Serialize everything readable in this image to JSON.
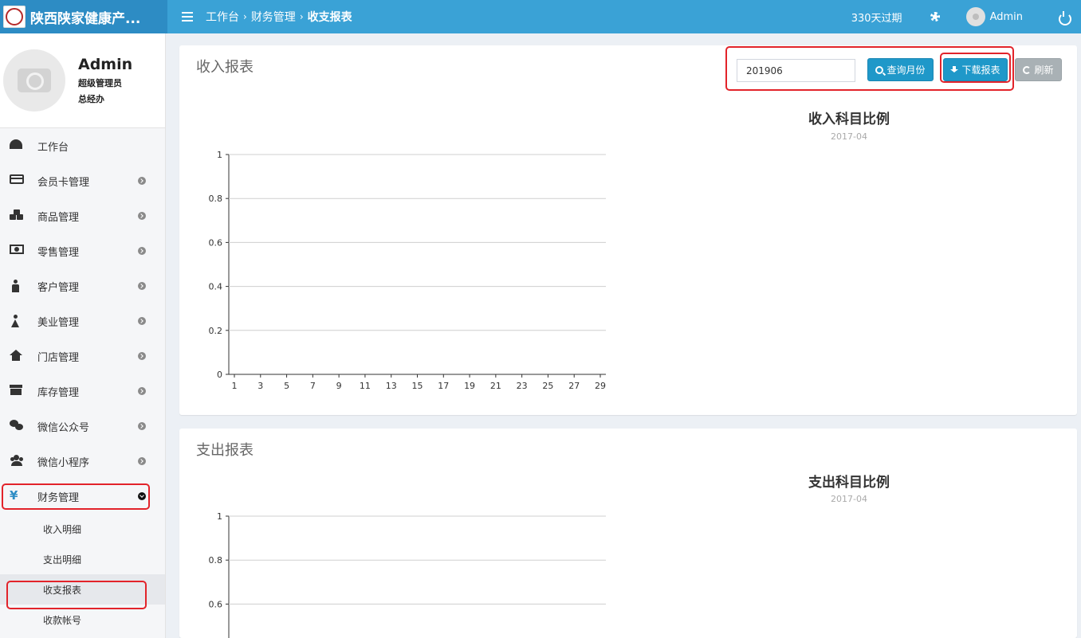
{
  "app": {
    "name": "陕西陕家健康产..."
  },
  "header": {
    "breadcrumb": [
      "工作台",
      "财务管理",
      "收支报表"
    ],
    "expire_text": "330天过期",
    "user_name": "Admin"
  },
  "sidebar": {
    "user": {
      "name": "Admin",
      "role": "超级管理员",
      "dept": "总经办"
    },
    "items": [
      {
        "label": "工作台",
        "icon": "dashboard-icon"
      },
      {
        "label": "会员卡管理",
        "icon": "credit-card-icon"
      },
      {
        "label": "商品管理",
        "icon": "cubes-icon"
      },
      {
        "label": "零售管理",
        "icon": "money-icon"
      },
      {
        "label": "客户管理",
        "icon": "male-icon"
      },
      {
        "label": "美业管理",
        "icon": "female-icon"
      },
      {
        "label": "门店管理",
        "icon": "home-icon"
      },
      {
        "label": "库存管理",
        "icon": "archive-icon"
      },
      {
        "label": "微信公众号",
        "icon": "wechat-icon"
      },
      {
        "label": "微信小程序",
        "icon": "users-icon"
      },
      {
        "label": "财务管理",
        "icon": "yen-icon",
        "active": true
      }
    ],
    "yen_glyph": "¥",
    "subitems": [
      {
        "label": "收入明细"
      },
      {
        "label": "支出明细"
      },
      {
        "label": "收支报表",
        "active": true
      },
      {
        "label": "收款帐号"
      }
    ]
  },
  "income": {
    "title": "收入报表",
    "month_value": "201906",
    "query_label": "查询月份",
    "download_label": "下载报表",
    "refresh_label": "刷新",
    "pie_title": "收入科目比例",
    "pie_subtitle": "2017-04"
  },
  "expense": {
    "title": "支出报表",
    "pie_title": "支出科目比例",
    "pie_subtitle": "2017-04"
  },
  "colors": {
    "header": "#3aa2d6",
    "logo_bg": "#2d8cc4",
    "primary_button": "#1f98c9",
    "refresh_button": "#a9b1b5",
    "highlight": "#e2232a"
  },
  "chart_data": [
    {
      "type": "bar",
      "x": [
        1,
        3,
        5,
        7,
        9,
        11,
        13,
        15,
        17,
        19,
        21,
        23,
        25,
        27,
        29
      ],
      "yticks": [
        0,
        0.2,
        0.4,
        0.6,
        0.8,
        1
      ],
      "ylim": [
        0,
        1
      ],
      "series": [],
      "grid": true
    },
    {
      "type": "bar",
      "yticks": [
        0.6,
        0.8,
        1
      ],
      "ylim": [
        0,
        1
      ],
      "series": [],
      "grid": true
    }
  ]
}
